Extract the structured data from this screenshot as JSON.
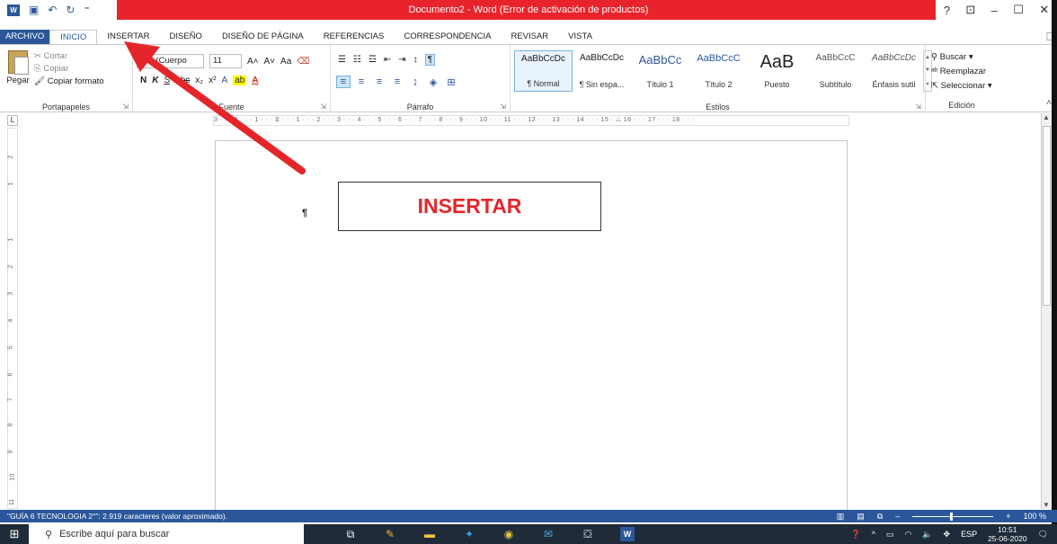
{
  "titlebar": {
    "title": "Documento2 - Word (Error de activación de productos)",
    "help": "?",
    "minimize": "–",
    "close": "✕"
  },
  "tabs": [
    "ARCHIVO",
    "INICIO",
    "INSERTAR",
    "DISEÑO",
    "DISEÑO DE PÁGINA",
    "REFERENCIAS",
    "CORRESPONDENCIA",
    "REVISAR",
    "VISTA"
  ],
  "active_tab": "INICIO",
  "clipboard": {
    "paste": "Pegar",
    "cut": "Cortar",
    "copy": "Copiar",
    "format_painter": "Copiar formato",
    "group_label": "Portapapeles"
  },
  "font": {
    "name": "libri (Cuerpo",
    "size": "11",
    "case": "Aa",
    "bold": "N",
    "italic": "K",
    "strike": "abc",
    "sub": "x₂",
    "sup": "x²",
    "group_label": "Fuente"
  },
  "paragraph": {
    "group_label": "Párrafo"
  },
  "styles": {
    "items": [
      {
        "preview": "AaBbCcDc",
        "name": "¶ Normal"
      },
      {
        "preview": "AaBbCcDc",
        "name": "¶ Sin espa..."
      },
      {
        "preview": "AaBbCc",
        "name": "Título 1"
      },
      {
        "preview": "AaBbCcC",
        "name": "Título 2"
      },
      {
        "preview": "AaB",
        "name": "Puesto"
      },
      {
        "preview": "AaBbCcC",
        "name": "Subtítulo"
      },
      {
        "preview": "AaBbCcDc",
        "name": "Énfasis sutil"
      }
    ],
    "group_label": "Estilos"
  },
  "editing": {
    "find": "Buscar",
    "replace": "Reemplazar",
    "select": "Seleccionar",
    "group_label": "Edición"
  },
  "ruler_text": "3 · · · 2 · · · 1 · · · ⧖ · · · 1 · · · 2 · · · 3 · · · 4 · · · 5 · · · 6 · · · 7 · · · 8 · · · 9 · · · 10 · · · 11 · · · 12 · · · 13 · · · 14 · · · 15 · △ 16 · · · 17 · · · 18 · · ·",
  "vruler_labels": [
    "2",
    "1",
    "1",
    "2",
    "3",
    "4",
    "5",
    "6",
    "7",
    "8",
    "9",
    "10",
    "11"
  ],
  "document": {
    "box_text": "INSERTAR",
    "pilcrow": "¶"
  },
  "statusbar": {
    "text": "\"GUÍA 6 TECNOLOGIA 2°\": 2.919 caracteres (valor aproximado).",
    "zoom": "100 %",
    "zoom_level_percent": 100
  },
  "taskbar": {
    "search_placeholder": "Escribe aquí para buscar",
    "language": "ESP",
    "time": "10:51",
    "date": "25-06-2020"
  }
}
